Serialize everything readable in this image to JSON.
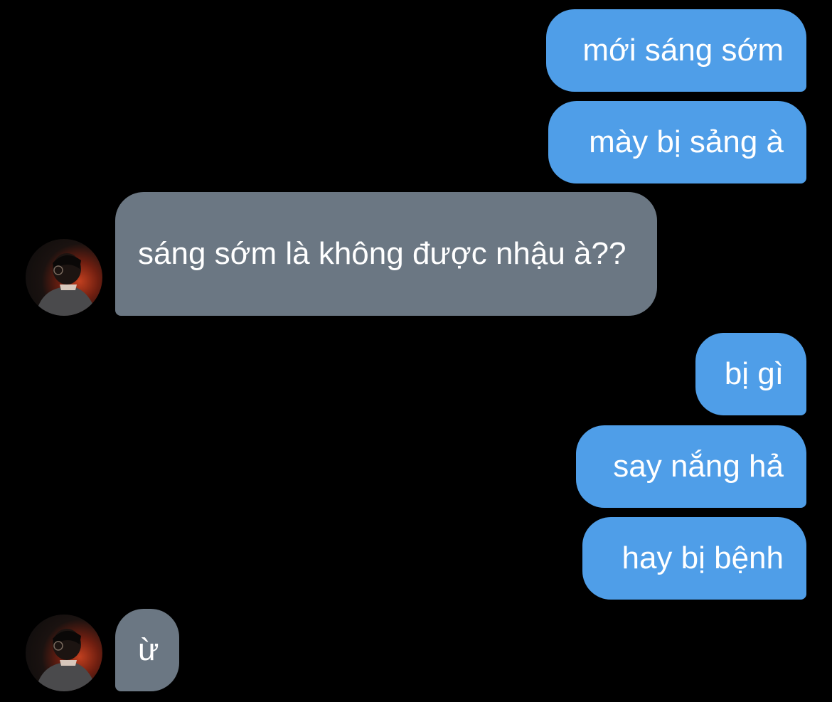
{
  "colors": {
    "background": "#000000",
    "outgoing_bubble": "#4f9ee8",
    "incoming_bubble": "#6b7783",
    "text": "#ffffff"
  },
  "messages": [
    {
      "direction": "outgoing",
      "text": "mới sáng sớm"
    },
    {
      "direction": "outgoing",
      "text": "mày bị sảng à"
    },
    {
      "direction": "incoming",
      "text": "sáng sớm là không được nhậu à??",
      "avatar": "contact-avatar"
    },
    {
      "direction": "outgoing",
      "text": "bị gì"
    },
    {
      "direction": "outgoing",
      "text": "say nắng hả"
    },
    {
      "direction": "outgoing",
      "text": "hay bị bệnh"
    },
    {
      "direction": "incoming",
      "text": "ừ",
      "avatar": "contact-avatar"
    }
  ]
}
